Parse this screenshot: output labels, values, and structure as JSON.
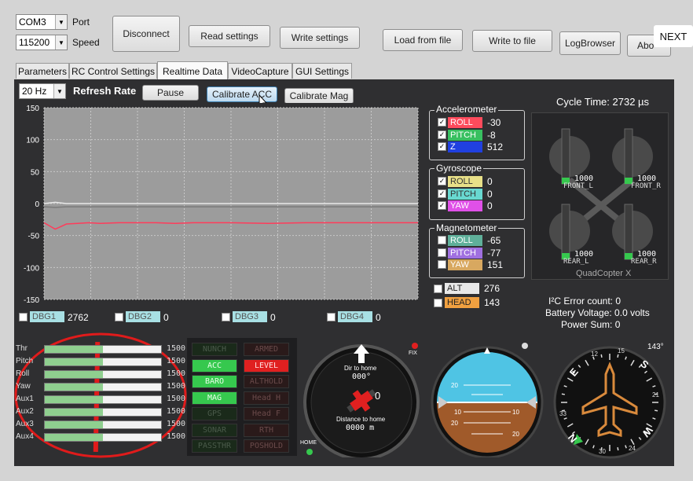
{
  "toolbar": {
    "port_value": "COM3",
    "port_label": "Port",
    "speed_value": "115200",
    "speed_label": "Speed",
    "disconnect": "Disconnect",
    "read_settings": "Read settings",
    "write_settings": "Write settings",
    "load_from_file": "Load from file",
    "write_to_file": "Write to file",
    "log_browser": "LogBrowser",
    "about": "Abo",
    "next": "NEXT"
  },
  "tabs": [
    "Parameters",
    "RC Control Settings",
    "Realtime Data",
    "VideoCapture",
    "GUI Settings"
  ],
  "active_tab": 2,
  "controls": {
    "refresh_rate_value": "20 Hz",
    "refresh_rate_label": "Refresh Rate",
    "pause": "Pause",
    "calibrate_acc": "Calibrate ACC",
    "calibrate_mag": "Calibrate Mag"
  },
  "chart_data": {
    "type": "line",
    "ylim": [
      -150,
      150
    ],
    "yticks": [
      150,
      100,
      50,
      0,
      -50,
      -100,
      -150
    ],
    "x": [
      0,
      3,
      6,
      9,
      12,
      15,
      20,
      25,
      30,
      35,
      40,
      50,
      60,
      70,
      80,
      90,
      100
    ],
    "series": [
      {
        "color": "#e8e8e8",
        "values": [
          0,
          2,
          0,
          0,
          0,
          0,
          0,
          0,
          0,
          0,
          0,
          0,
          0,
          0,
          0,
          0,
          0
        ]
      },
      {
        "color": "#7a7a7a",
        "values": [
          -5,
          -6,
          -5,
          -5,
          -5,
          -5,
          -5,
          -5,
          -5,
          -5,
          -5,
          -5,
          -5,
          -5,
          -5,
          -5,
          -5
        ]
      },
      {
        "color": "#ff3b5a",
        "values": [
          -30,
          -40,
          -32,
          -31,
          -30,
          -31,
          -30,
          -30,
          -30,
          -31,
          -30,
          -30,
          -31,
          -30,
          -30,
          -30,
          -30
        ]
      }
    ]
  },
  "accelerometer": {
    "title": "Accelerometer",
    "rows": [
      {
        "label": "ROLL",
        "value": "-30",
        "color": "#ff4b5c",
        "text_color": "#ffffff"
      },
      {
        "label": "PITCH",
        "value": "-8",
        "color": "#38c060",
        "text_color": "#ffffff"
      },
      {
        "label": "Z",
        "value": "512",
        "color": "#2040e0",
        "text_color": "#ffffff"
      }
    ]
  },
  "gyroscope": {
    "title": "Gyroscope",
    "rows": [
      {
        "label": "ROLL",
        "value": "0",
        "color": "#e8e088",
        "text_color": "#333333"
      },
      {
        "label": "PITCH",
        "value": "0",
        "color": "#68d8d0",
        "text_color": "#333333"
      },
      {
        "label": "YAW",
        "value": "0",
        "color": "#e050e8",
        "text_color": "#ffffff"
      }
    ]
  },
  "magnetometer": {
    "title": "Magnetometer",
    "rows": [
      {
        "label": "ROLL",
        "value": "-65",
        "color": "#5fb09a",
        "text_color": "#ffffff"
      },
      {
        "label": "PITCH",
        "value": "-77",
        "color": "#a070e0",
        "text_color": "#ffffff"
      },
      {
        "label": "YAW",
        "value": "151",
        "color": "#d8a860",
        "text_color": "#ffffff"
      }
    ]
  },
  "alt": {
    "label": "ALT",
    "value": "276",
    "color": "#e8e8e8"
  },
  "head": {
    "label": "HEAD",
    "value": "143",
    "color": "#f0a040"
  },
  "debug": [
    {
      "label": "DBG1",
      "value": "2762"
    },
    {
      "label": "DBG2",
      "value": "0"
    },
    {
      "label": "DBG3",
      "value": "0"
    },
    {
      "label": "DBG4",
      "value": "0"
    }
  ],
  "cycle_time": "Cycle Time:  2732 µs",
  "motors": {
    "front_l": {
      "value": "1000",
      "label": "FRONT_L"
    },
    "front_r": {
      "value": "1000",
      "label": "FRONT_R"
    },
    "rear_l": {
      "value": "1000",
      "label": "REAR_L"
    },
    "rear_r": {
      "value": "1000",
      "label": "REAR_R"
    },
    "model": "QuadCopter X"
  },
  "status": {
    "i2c_errors": "I²C Error count:  0",
    "battery": "Battery Voltage:  0.0 volts",
    "power_sum": "Power Sum:  0"
  },
  "rc": [
    {
      "label": "Thr",
      "value": "1500",
      "fill": 0.5
    },
    {
      "label": "Pitch",
      "value": "1500",
      "fill": 0.5
    },
    {
      "label": "Roll",
      "value": "1500",
      "fill": 0.5
    },
    {
      "label": "Yaw",
      "value": "1500",
      "fill": 0.5
    },
    {
      "label": "Aux1",
      "value": "1500",
      "fill": 0.5
    },
    {
      "label": "Aux2",
      "value": "1500",
      "fill": 0.5
    },
    {
      "label": "Aux3",
      "value": "1500",
      "fill": 0.5
    },
    {
      "label": "Aux4",
      "value": "1500",
      "fill": 0.5
    }
  ],
  "indicators": {
    "left": [
      {
        "label": "NUNCH",
        "on": false
      },
      {
        "label": "ACC",
        "on": true
      },
      {
        "label": "BARO",
        "on": true
      },
      {
        "label": "MAG",
        "on": true
      },
      {
        "label": "GPS",
        "on": false
      },
      {
        "label": "SONAR",
        "on": false
      },
      {
        "label": "PASSTHR",
        "on": false
      }
    ],
    "right": [
      {
        "label": "ARMED",
        "on": false
      },
      {
        "label": "LEVEL",
        "on": true
      },
      {
        "label": "ALTHOLD",
        "on": false
      },
      {
        "label": "Head H",
        "on": false
      },
      {
        "label": "Head F",
        "on": false
      },
      {
        "label": "RTH",
        "on": false
      },
      {
        "label": "POSHOLD",
        "on": false
      }
    ]
  },
  "gps": {
    "dir_label": "Dir to home",
    "dir_value": "000°",
    "sat_count": "0",
    "dist_label": "Distance to home",
    "dist_value": "0000 m",
    "fix_label": "FIX",
    "home_label": "HOME"
  },
  "horizon": {
    "marks": [
      "20",
      "10",
      "10",
      "20",
      "20"
    ]
  },
  "compass": {
    "heading": "143°",
    "letters": [
      "E",
      "S",
      "W",
      "N"
    ],
    "numbers": [
      "12",
      "15",
      "21",
      "24",
      "30",
      "33"
    ]
  },
  "colors": {
    "panel": "#2f2f31",
    "led_green": "#36c84e",
    "led_red": "#e02020",
    "sky": "#4fc4e4",
    "ground": "#a05a2a",
    "plane": "#d98a3c",
    "annotation": "#e01b1b"
  }
}
